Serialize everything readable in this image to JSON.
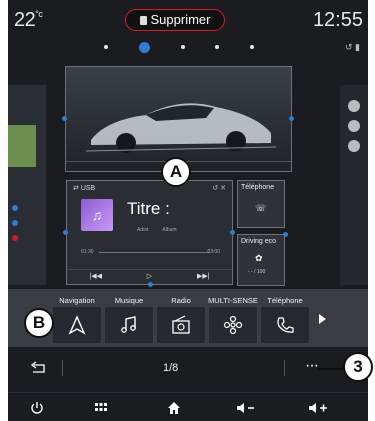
{
  "status_bar": {
    "temperature": "22",
    "temperature_unit": "°c",
    "delete_label": "Supprimer",
    "clock": "12:55"
  },
  "pagination_dots": {
    "count": 5,
    "active_index": 1
  },
  "widgets": {
    "media": {
      "source": "USB",
      "title": "Titre :",
      "artist": "Artist",
      "album": "Album",
      "time_elapsed": "01:30",
      "time_total": "03:00"
    },
    "phone": {
      "title": "Téléphone"
    },
    "driving_eco": {
      "title": "Driving eco",
      "value": "- - / 100"
    }
  },
  "shortcuts": [
    {
      "label": "Navigation",
      "icon": "navigation-arrow-icon"
    },
    {
      "label": "Musique",
      "icon": "music-note-icon"
    },
    {
      "label": "Radio",
      "icon": "radio-icon"
    },
    {
      "label": "MULTI-SENSE",
      "icon": "multi-sense-icon"
    },
    {
      "label": "Téléphone",
      "icon": "phone-icon"
    }
  ],
  "page_indicator": "1/8",
  "callouts": {
    "a": "A",
    "b": "B",
    "three": "3"
  },
  "colors": {
    "accent": "#2f7dd1",
    "delete_border": "#d5192c",
    "screen_bg": "#1a1c20"
  },
  "nav_icons": [
    "power-icon",
    "apps-grid-icon",
    "home-icon",
    "volume-down-icon",
    "volume-up-icon"
  ]
}
